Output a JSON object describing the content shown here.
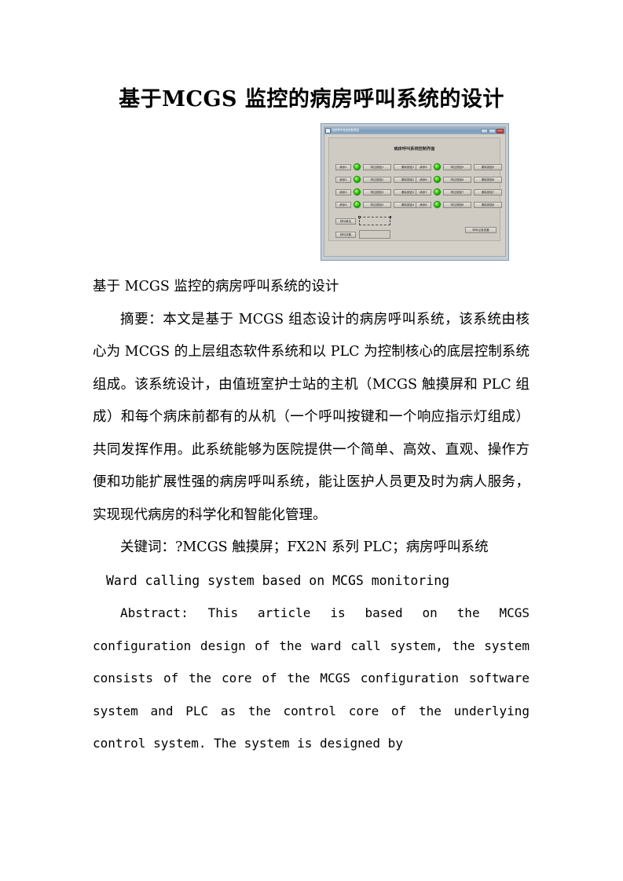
{
  "document": {
    "title": "基于MCGS 监控的病房呼叫系统的设计",
    "paragraphs": {
      "subtitle": "基于 MCGS 监控的病房呼叫系统的设计",
      "abstract_cn": "摘要：本文是基于 MCGS 组态设计的病房呼叫系统，该系统由核心为 MCGS 的上层组态软件系统和以 PLC 为控制核心的底层控制系统组成。该系统设计，由值班室护士站的主机（MCGS 触摸屏和 PLC 组成）和每个病床前都有的从机（一个呼叫按键和一个响应指示灯组成）共同发挥作用。此系统能够为医院提供一个简单、高效、直观、操作方便和功能扩展性强的病房呼叫系统，能让医护人员更及时为病人服务，实现现代病房的科学化和智能化管理。",
      "keywords_cn": "关键词：?MCGS 触摸屏；FX2N 系列 PLC；病房呼叫系统",
      "title_en": "Ward calling system based on MCGS monitoring",
      "abstract_en": "Abstract: This article is based on the MCGS configuration design of the ward call system, the system consists of the core of the MCGS configuration software system and PLC as the control core of the underlying control system. The system is designed by"
    }
  },
  "figure": {
    "window": {
      "title": "病房呼叫系统控制界面",
      "buttons": {
        "minimize": "—",
        "maximize": "□",
        "close": "×"
      },
      "panel_title": "病床呼叫系统控制界面",
      "beds_left": [
        {
          "bed": "病床1",
          "led": "on",
          "call": "呼应按钮1",
          "clear": "清除按钮1"
        },
        {
          "bed": "病床2",
          "led": "on",
          "call": "呼应按钮2",
          "clear": "清除按钮2"
        },
        {
          "bed": "病床3",
          "led": "on",
          "call": "呼应按钮3",
          "clear": "清除按钮3"
        },
        {
          "bed": "病床4",
          "led": "on",
          "call": "呼应按钮4",
          "clear": "清除按钮4"
        }
      ],
      "beds_right": [
        {
          "bed": "病床5",
          "led": "on",
          "call": "呼应按钮5",
          "clear": "清除按钮5"
        },
        {
          "bed": "病床6",
          "led": "on",
          "call": "呼应按钮6",
          "clear": "清除按钮6"
        },
        {
          "bed": "病床7",
          "led": "on",
          "call": "呼应按钮7",
          "clear": "清除按钮7"
        },
        {
          "bed": "病床8",
          "led": "on",
          "call": "呼应按钮8",
          "clear": "清除按钮8"
        }
      ],
      "controls": [
        {
          "label": "呼叫单位",
          "value": ""
        },
        {
          "label": "呼叫次数",
          "value": ""
        }
      ],
      "corner_button": "呼叫记录查看"
    },
    "colors": {
      "led_on": "#41e016",
      "panel_bg": "#cfcbc3",
      "window_bg": "#d4d0c8",
      "titlebar": "#7e9cba",
      "close_button": "#b63a2c",
      "figure_border": "#7d9ab5"
    }
  }
}
